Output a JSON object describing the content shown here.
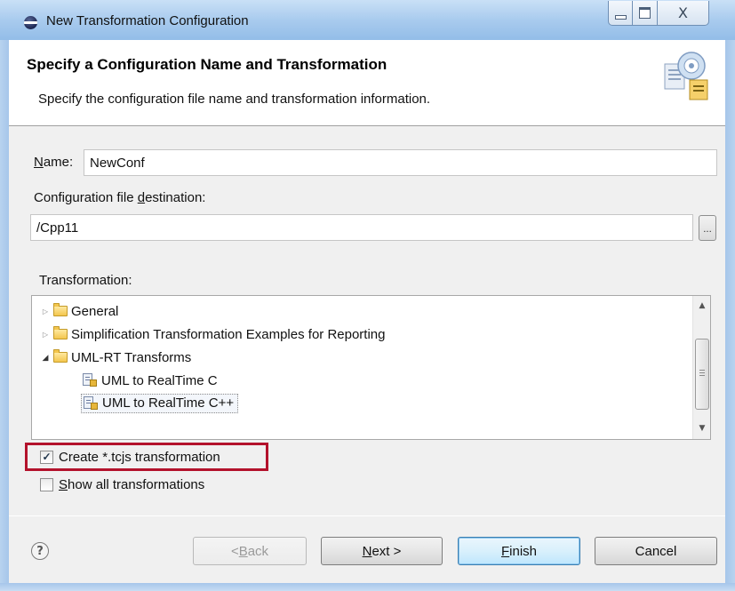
{
  "window": {
    "title": "New Transformation Configuration",
    "close_glyph": "X"
  },
  "header": {
    "title": "Specify a Configuration Name and Transformation",
    "description": "Specify the configuration file name and transformation information.",
    "icon": "wizard-banner-icon"
  },
  "form": {
    "name_label_mnemonic": "N",
    "name_label_rest": "ame:",
    "name_value": "NewConf",
    "destination_label_pre": "Configuration file ",
    "destination_label_mnemonic": "d",
    "destination_label_post": "estination:",
    "destination_value": "/Cpp11",
    "browse_label": "..."
  },
  "transformation": {
    "label": "Transformation:",
    "items": [
      {
        "label": "General",
        "level": 0,
        "expanded": false,
        "icon": "folder-icon"
      },
      {
        "label": "Simplification Transformation Examples for Reporting",
        "level": 0,
        "expanded": false,
        "icon": "folder-icon"
      },
      {
        "label": "UML-RT Transforms",
        "level": 0,
        "expanded": true,
        "icon": "folder-icon"
      },
      {
        "label": "UML to RealTime C",
        "level": 1,
        "icon": "transform-icon"
      },
      {
        "label": "UML to RealTime C++",
        "level": 1,
        "selected": true,
        "icon": "transform-icon"
      }
    ]
  },
  "options": {
    "create_tcjs": {
      "label": "Create *.tcjs transformation",
      "checked": true
    },
    "show_all": {
      "label_mnemonic": "S",
      "label_rest": "how all transformations",
      "checked": false
    }
  },
  "buttons": {
    "help": "?",
    "back_pre": "< ",
    "back_mnemonic": "B",
    "back_rest": "ack",
    "next_mnemonic": "N",
    "next_rest": "ext >",
    "finish_mnemonic": "F",
    "finish_rest": "inish",
    "cancel": "Cancel"
  },
  "colors": {
    "highlight": "#b3122c",
    "default_button": "#3c7fb1"
  }
}
